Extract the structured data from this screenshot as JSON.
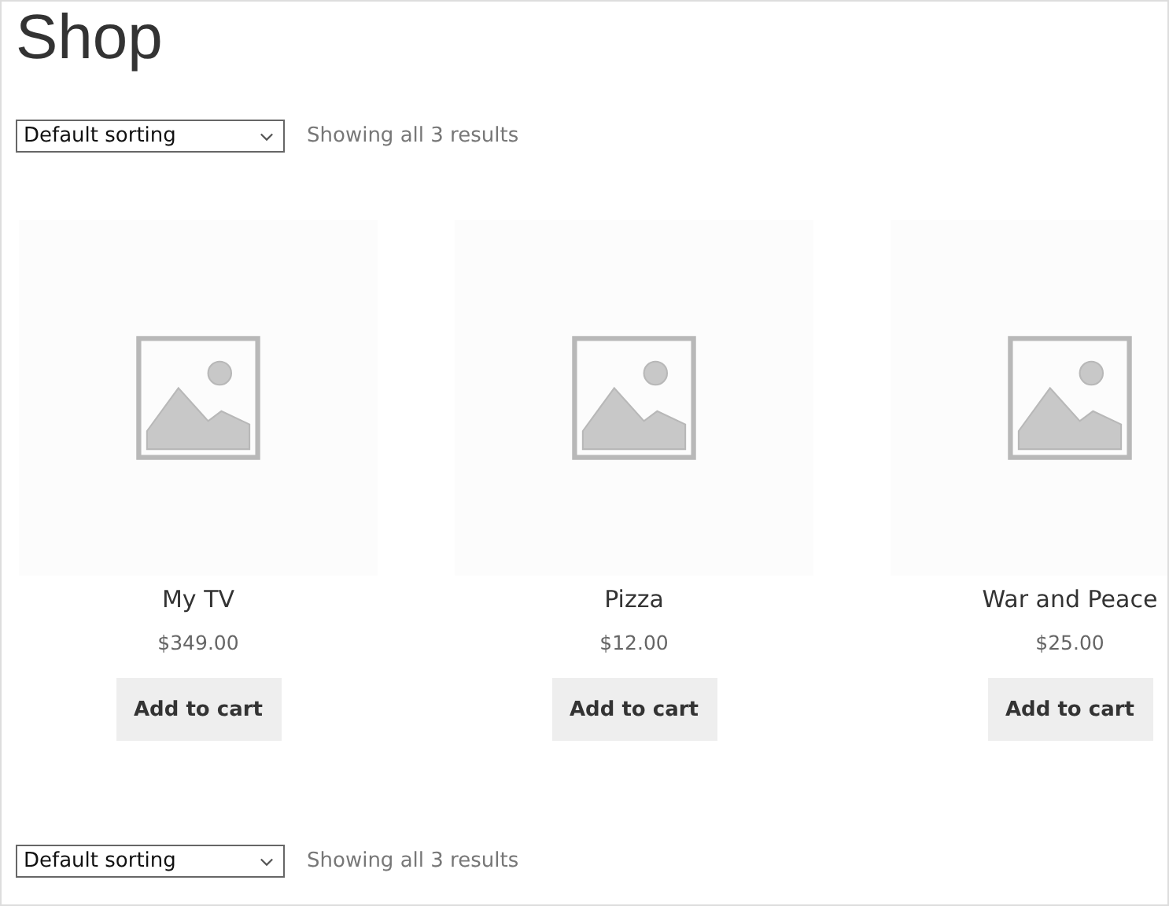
{
  "title": "Shop",
  "sorting_top": {
    "value": "Default sorting",
    "result_count": "Showing all 3 results"
  },
  "products": [
    {
      "name": "My TV",
      "price": "$349.00",
      "button": "Add to cart"
    },
    {
      "name": "Pizza",
      "price": "$12.00",
      "button": "Add to cart"
    },
    {
      "name": "War and Peace",
      "price": "$25.00",
      "button": "Add to cart"
    }
  ],
  "sorting_bottom": {
    "value": "Default sorting",
    "result_count": "Showing all 3 results"
  }
}
